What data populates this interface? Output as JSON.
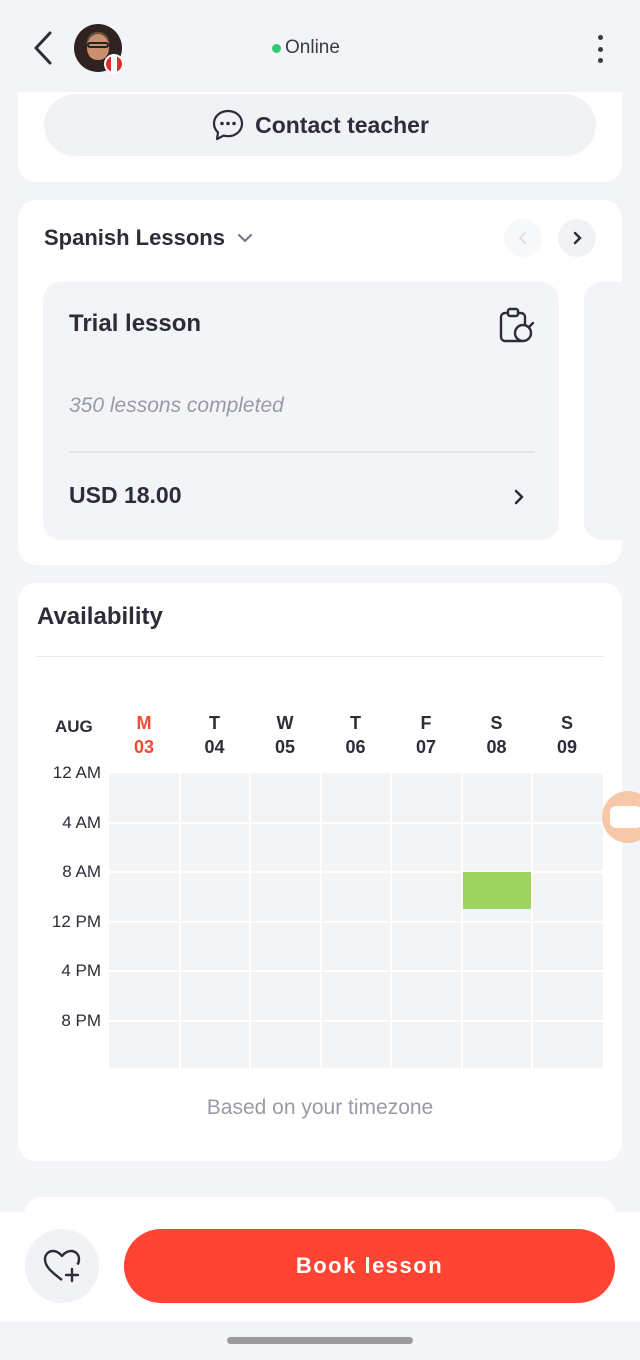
{
  "header": {
    "status_text": "Online",
    "status_color": "#2ecc71",
    "icons": {
      "back": "chevron-left-icon",
      "more": "more-vertical-icon",
      "flag": "canada-flag-icon"
    }
  },
  "contact": {
    "label": "Contact teacher",
    "icon": "chat-bubble-icon"
  },
  "lessons": {
    "subject": "Spanish Lessons",
    "items": [
      {
        "title": "Trial lesson",
        "completed": "350 lessons completed",
        "price": "USD 18.00",
        "icon": "clipboard-search-icon"
      }
    ]
  },
  "availability": {
    "title": "Availability",
    "month": "AUG",
    "days": [
      {
        "dow": "M",
        "date": "03",
        "today": true
      },
      {
        "dow": "T",
        "date": "04",
        "today": false
      },
      {
        "dow": "W",
        "date": "05",
        "today": false
      },
      {
        "dow": "T",
        "date": "06",
        "today": false
      },
      {
        "dow": "F",
        "date": "07",
        "today": false
      },
      {
        "dow": "S",
        "date": "08",
        "today": false
      },
      {
        "dow": "S",
        "date": "09",
        "today": false
      }
    ],
    "times": [
      "12 AM",
      "4 AM",
      "8 AM",
      "12 PM",
      "4 PM",
      "8 PM"
    ],
    "available_slots": [
      {
        "day": "08",
        "start": "8 AM",
        "end": "11 AM"
      }
    ],
    "available_color": "#9fd55f",
    "note": "Based on your timezone"
  },
  "footer": {
    "book_label": "Book lesson",
    "book_color": "#ff4433",
    "favorite_icon": "heart-plus-icon"
  }
}
